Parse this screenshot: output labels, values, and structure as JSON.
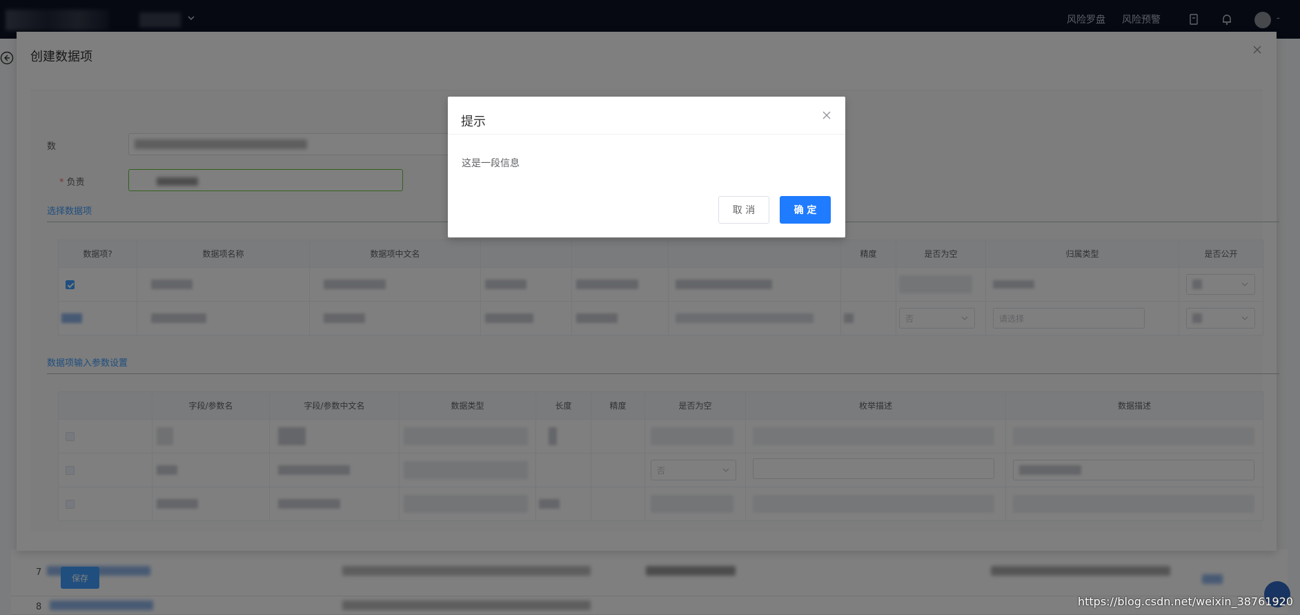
{
  "topbar": {
    "nav_links": [
      "风险罗盘",
      "风险预警"
    ],
    "avatar_suffix": "-"
  },
  "background": {
    "row_indices": [
      "7",
      "8"
    ]
  },
  "drawer": {
    "title": "创建数据项",
    "form": {
      "field1_label": "数",
      "field2_required": "*",
      "field2_label": "负责"
    },
    "section1_title": "选择数据项",
    "table1": {
      "headers": [
        "数据项?",
        "数据项名称",
        "数据项中文名",
        "",
        "",
        "",
        "精度",
        "是否为空",
        "归属类型",
        "是否公开"
      ],
      "row2_nullable": "否",
      "row2_type_placeholder": "请选择"
    },
    "section2_title": "数据项输入参数设置",
    "table2": {
      "headers": [
        "",
        "字段/参数名",
        "字段/参数中文名",
        "数据类型",
        "长度",
        "精度",
        "是否为空",
        "枚举描述",
        "数据描述"
      ],
      "row2_nullable": "否"
    },
    "save_label": "保存"
  },
  "msgbox": {
    "title": "提示",
    "content": "这是一段信息",
    "cancel_label": "取 消",
    "confirm_label": "确 定"
  },
  "watermark": "https://blog.csdn.net/weixin_38761920",
  "colors": {
    "topbar": "#0c1124",
    "primary": "#1f7bff",
    "link": "#409eff",
    "success_border": "#67c23a"
  }
}
